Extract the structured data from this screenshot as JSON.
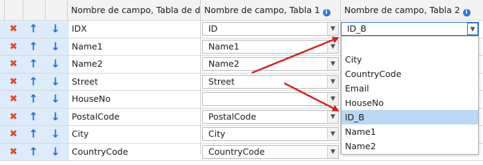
{
  "header": {
    "col_target": "Nombre de campo, Tabla de des",
    "col_t1": "Nombre de campo, Tabla 1",
    "col_t2": "Nombre de campo, Tabla 2",
    "info_glyph": "i"
  },
  "rows": [
    {
      "target": "IDX",
      "t1": "ID",
      "t2": "ID_B"
    },
    {
      "target": "Name1",
      "t1": "Name1",
      "t2": ""
    },
    {
      "target": "Name2",
      "t1": "Name2",
      "t2": ""
    },
    {
      "target": "Street",
      "t1": "Street",
      "t2": ""
    },
    {
      "target": "HouseNo",
      "t1": "",
      "t2": ""
    },
    {
      "target": "PostalCode",
      "t1": "PostalCode",
      "t2": ""
    },
    {
      "target": "City",
      "t1": "City",
      "t2": ""
    },
    {
      "target": "CountryCode",
      "t1": "CountryCode",
      "t2": ""
    }
  ],
  "dropdown": {
    "options": [
      "",
      "City",
      "CountryCode",
      "Email",
      "HouseNo",
      "ID_B",
      "Name1",
      "Name2"
    ],
    "highlighted": "ID_B"
  },
  "icons": {
    "delete": "delete-x-icon",
    "up": "arrow-up-icon",
    "down": "arrow-down-icon",
    "chevron": "chevron-down-icon",
    "info": "info-icon"
  },
  "colors": {
    "delete": "#e04a24",
    "arrow": "#1f6fd1",
    "highlight": "#b8d8f4",
    "annotation": "#d42020"
  }
}
